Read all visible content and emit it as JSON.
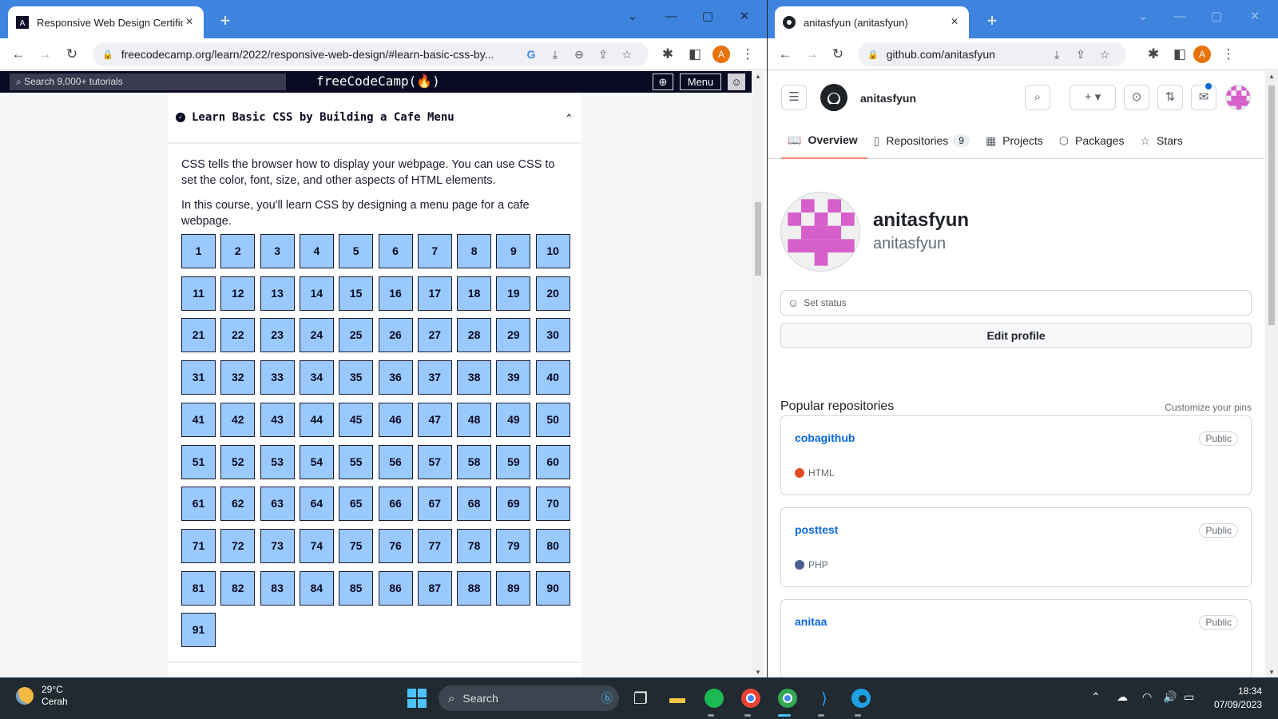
{
  "left_browser": {
    "tab_title": "Responsive Web Design Certifica",
    "url": "freecodecamp.org/learn/2022/responsive-web-design/#learn-basic-css-by...",
    "profile_initial": "A",
    "fcc": {
      "search_placeholder": "Search 9,000+ tutorials",
      "logo": "freeCodeCamp(🔥)",
      "menu_label": "Menu",
      "block_title": "Learn Basic CSS by Building a Cafe Menu",
      "desc1": "CSS tells the browser how to display your webpage. You can use CSS to set the color, font, size, and other aspects of HTML elements.",
      "desc2": "In this course, you'll learn CSS by designing a menu page for a cafe webpage.",
      "step_count": 91
    }
  },
  "right_browser": {
    "tab_title": "anitasfyun (anitasfyun)",
    "url": "github.com/anitasfyun",
    "profile_initial": "A",
    "github": {
      "header_username": "anitasfyun",
      "tabs": [
        {
          "label": "Overview",
          "icon": "book-icon",
          "active": true
        },
        {
          "label": "Repositories",
          "icon": "repo-icon",
          "count": "9"
        },
        {
          "label": "Projects",
          "icon": "table-icon"
        },
        {
          "label": "Packages",
          "icon": "package-icon"
        },
        {
          "label": "Stars",
          "icon": "star-icon"
        }
      ],
      "profile_name": "anitasfyun",
      "profile_login": "anitasfyun",
      "set_status": "Set status",
      "edit_profile": "Edit profile",
      "popular_heading": "Popular repositories",
      "customize": "Customize your pins",
      "repos": [
        {
          "name": "cobagithub",
          "visibility": "Public",
          "language": "HTML",
          "color": "#e34c26"
        },
        {
          "name": "posttest",
          "visibility": "Public",
          "language": "PHP",
          "color": "#4F5D95"
        },
        {
          "name": "anitaa",
          "visibility": "Public",
          "language": "",
          "color": ""
        }
      ]
    }
  },
  "taskbar": {
    "temperature": "29°C",
    "weather": "Cerah",
    "search": "Search",
    "time": "18:34",
    "date": "07/09/2023"
  },
  "colors": {
    "chrome_frame": "#3e84df",
    "fcc_nav": "#0a0a23",
    "step_fill": "#99c9ff",
    "gh_avatar": "#d65fcb"
  }
}
